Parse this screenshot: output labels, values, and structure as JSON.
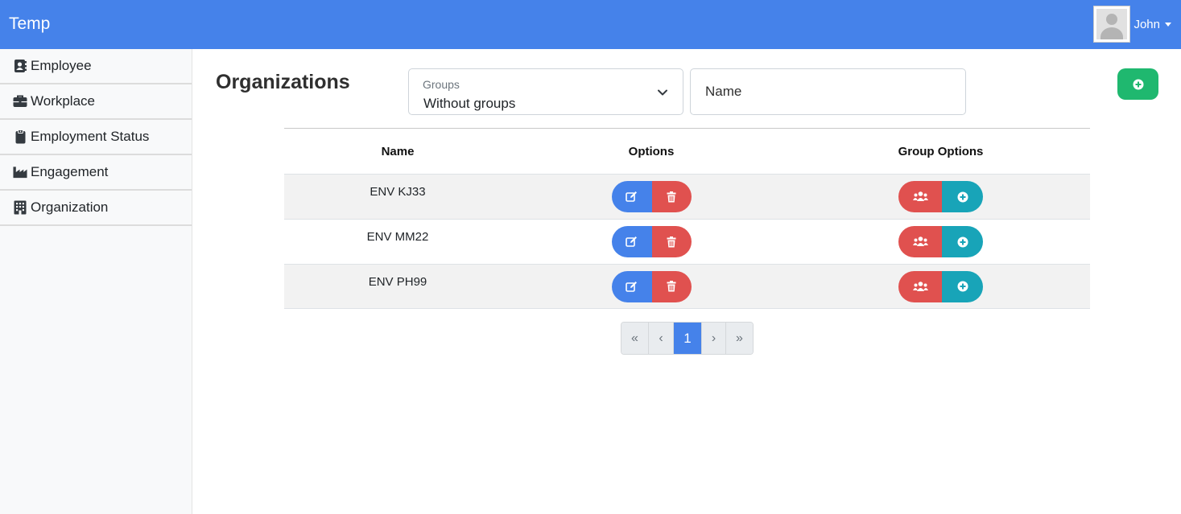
{
  "app": {
    "brand": "Temp"
  },
  "user": {
    "name": "John"
  },
  "sidebar": {
    "items": [
      {
        "label": "Employee",
        "icon": "address-book-icon"
      },
      {
        "label": "Workplace",
        "icon": "briefcase-icon"
      },
      {
        "label": "Employment Status",
        "icon": "clipboard-icon"
      },
      {
        "label": "Engagement",
        "icon": "industry-icon"
      },
      {
        "label": "Organization",
        "icon": "building-icon"
      }
    ]
  },
  "page": {
    "title": "Organizations"
  },
  "filters": {
    "groups": {
      "label": "Groups",
      "value": "Without groups"
    },
    "name": {
      "placeholder": "Name"
    }
  },
  "colors": {
    "primary": "#4582ea",
    "danger": "#e0514f",
    "success": "#1fb86f",
    "info": "#18a4b8"
  },
  "table": {
    "headers": {
      "name": "Name",
      "options": "Options",
      "group_options": "Group Options"
    },
    "rows": [
      {
        "name": "ENV KJ33"
      },
      {
        "name": "ENV MM22"
      },
      {
        "name": "ENV PH99"
      }
    ]
  },
  "pagination": {
    "first": "«",
    "prev": "‹",
    "current": "1",
    "next": "›",
    "last": "»"
  }
}
